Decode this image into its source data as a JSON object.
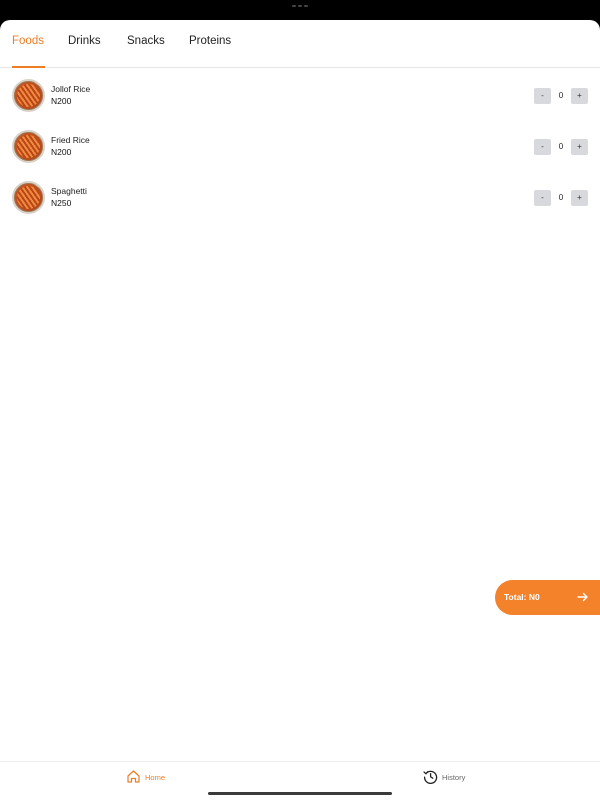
{
  "tabs": [
    {
      "label": "Foods",
      "active": true
    },
    {
      "label": "Drinks",
      "active": false
    },
    {
      "label": "Snacks",
      "active": false
    },
    {
      "label": "Proteins",
      "active": false
    }
  ],
  "items": [
    {
      "name": "Jollof Rice",
      "price": "N200",
      "qty": "0",
      "minus": "-",
      "plus": "+"
    },
    {
      "name": "Fried Rice",
      "price": "N200",
      "qty": "0",
      "minus": "-",
      "plus": "+"
    },
    {
      "name": "Spaghetti",
      "price": "N250",
      "qty": "0",
      "minus": "-",
      "plus": "+"
    }
  ],
  "total": {
    "label": "Total: N0",
    "icon": "arrow-right-icon"
  },
  "nav": {
    "home": {
      "label": "Home",
      "icon": "home-icon"
    },
    "history": {
      "label": "History",
      "icon": "history-icon"
    }
  },
  "colors": {
    "accent": "#ee7d24",
    "button_bg": "#f4822a",
    "stepper_bg": "#d7d9dd"
  }
}
